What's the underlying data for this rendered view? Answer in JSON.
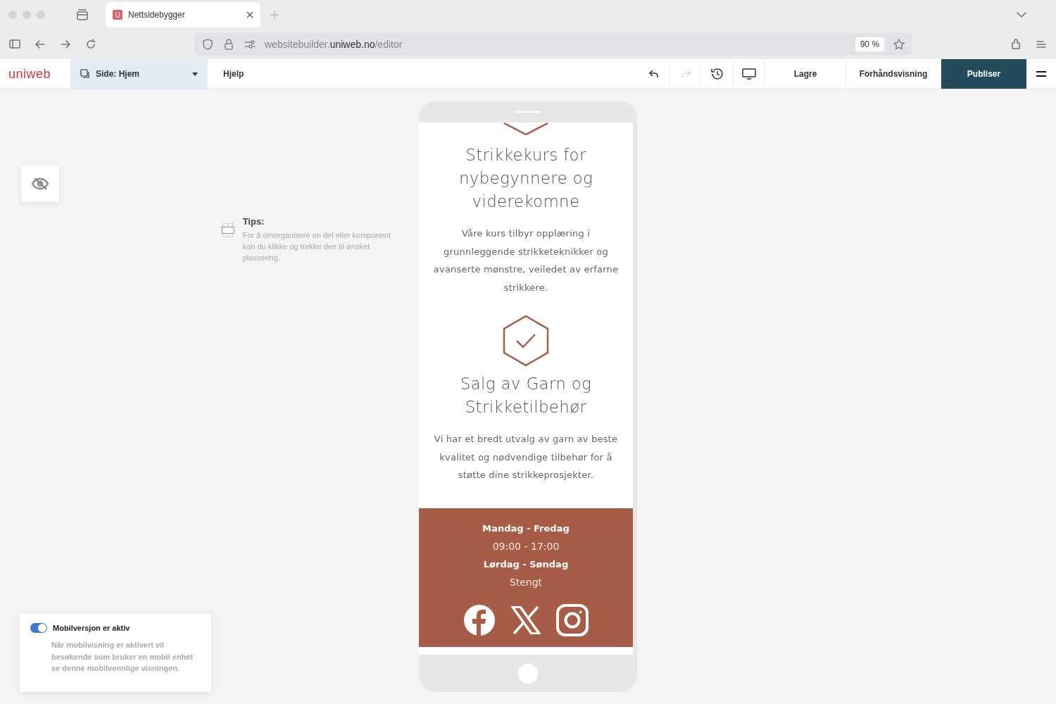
{
  "browser": {
    "tab_icon": "U",
    "tab_title": "Nettsidebygger",
    "url": "websitebuilder.**uniweb.no**/editor",
    "zoom": "90 %"
  },
  "toolbar": {
    "logo": "uniweb",
    "page_label": "Side:",
    "page_name": "Hjem",
    "help": "Hjelp",
    "redo_disabled": true,
    "save": "Lagre",
    "preview": "Forhåndsvisning",
    "publish": "Publiser"
  },
  "tips": {
    "title": "Tips:",
    "text": "For å omorganisere en del eller komponent kan du klikke og trekke den til ønsket plassering."
  },
  "mobile_toggle": {
    "label": "Mobilversjon er aktiv",
    "on": true,
    "description": "Når mobilvisning er aktivert vil besøkende som bruker en mobil enhet se denne mobilvennlige visningen."
  },
  "phone": {
    "sections": [
      {
        "kind": "text",
        "title": "Strikkekurs for nybegynnere og viderekomne",
        "body": "Våre kurs tilbyr opplæring i grunnleggende strikketeknikker og avanserte mønstre, veiledet av erfarne strikkere."
      },
      {
        "kind": "check",
        "title": "Salg av Garn og Strikketilbehør",
        "body": "Vi har et bredt utvalg av garn av beste kvalitet og nødvendige tilbehør for å støtte dine strikkeprosjekter."
      }
    ],
    "hours": [
      {
        "days": "Mandag - Fredag",
        "time": "09:00 - 17:00"
      },
      {
        "days": "Lørdag - Søndag",
        "time": "Stengt"
      }
    ],
    "socials": [
      {
        "kind": "facebook"
      },
      {
        "kind": "x"
      },
      {
        "kind": "instagram"
      }
    ]
  }
}
